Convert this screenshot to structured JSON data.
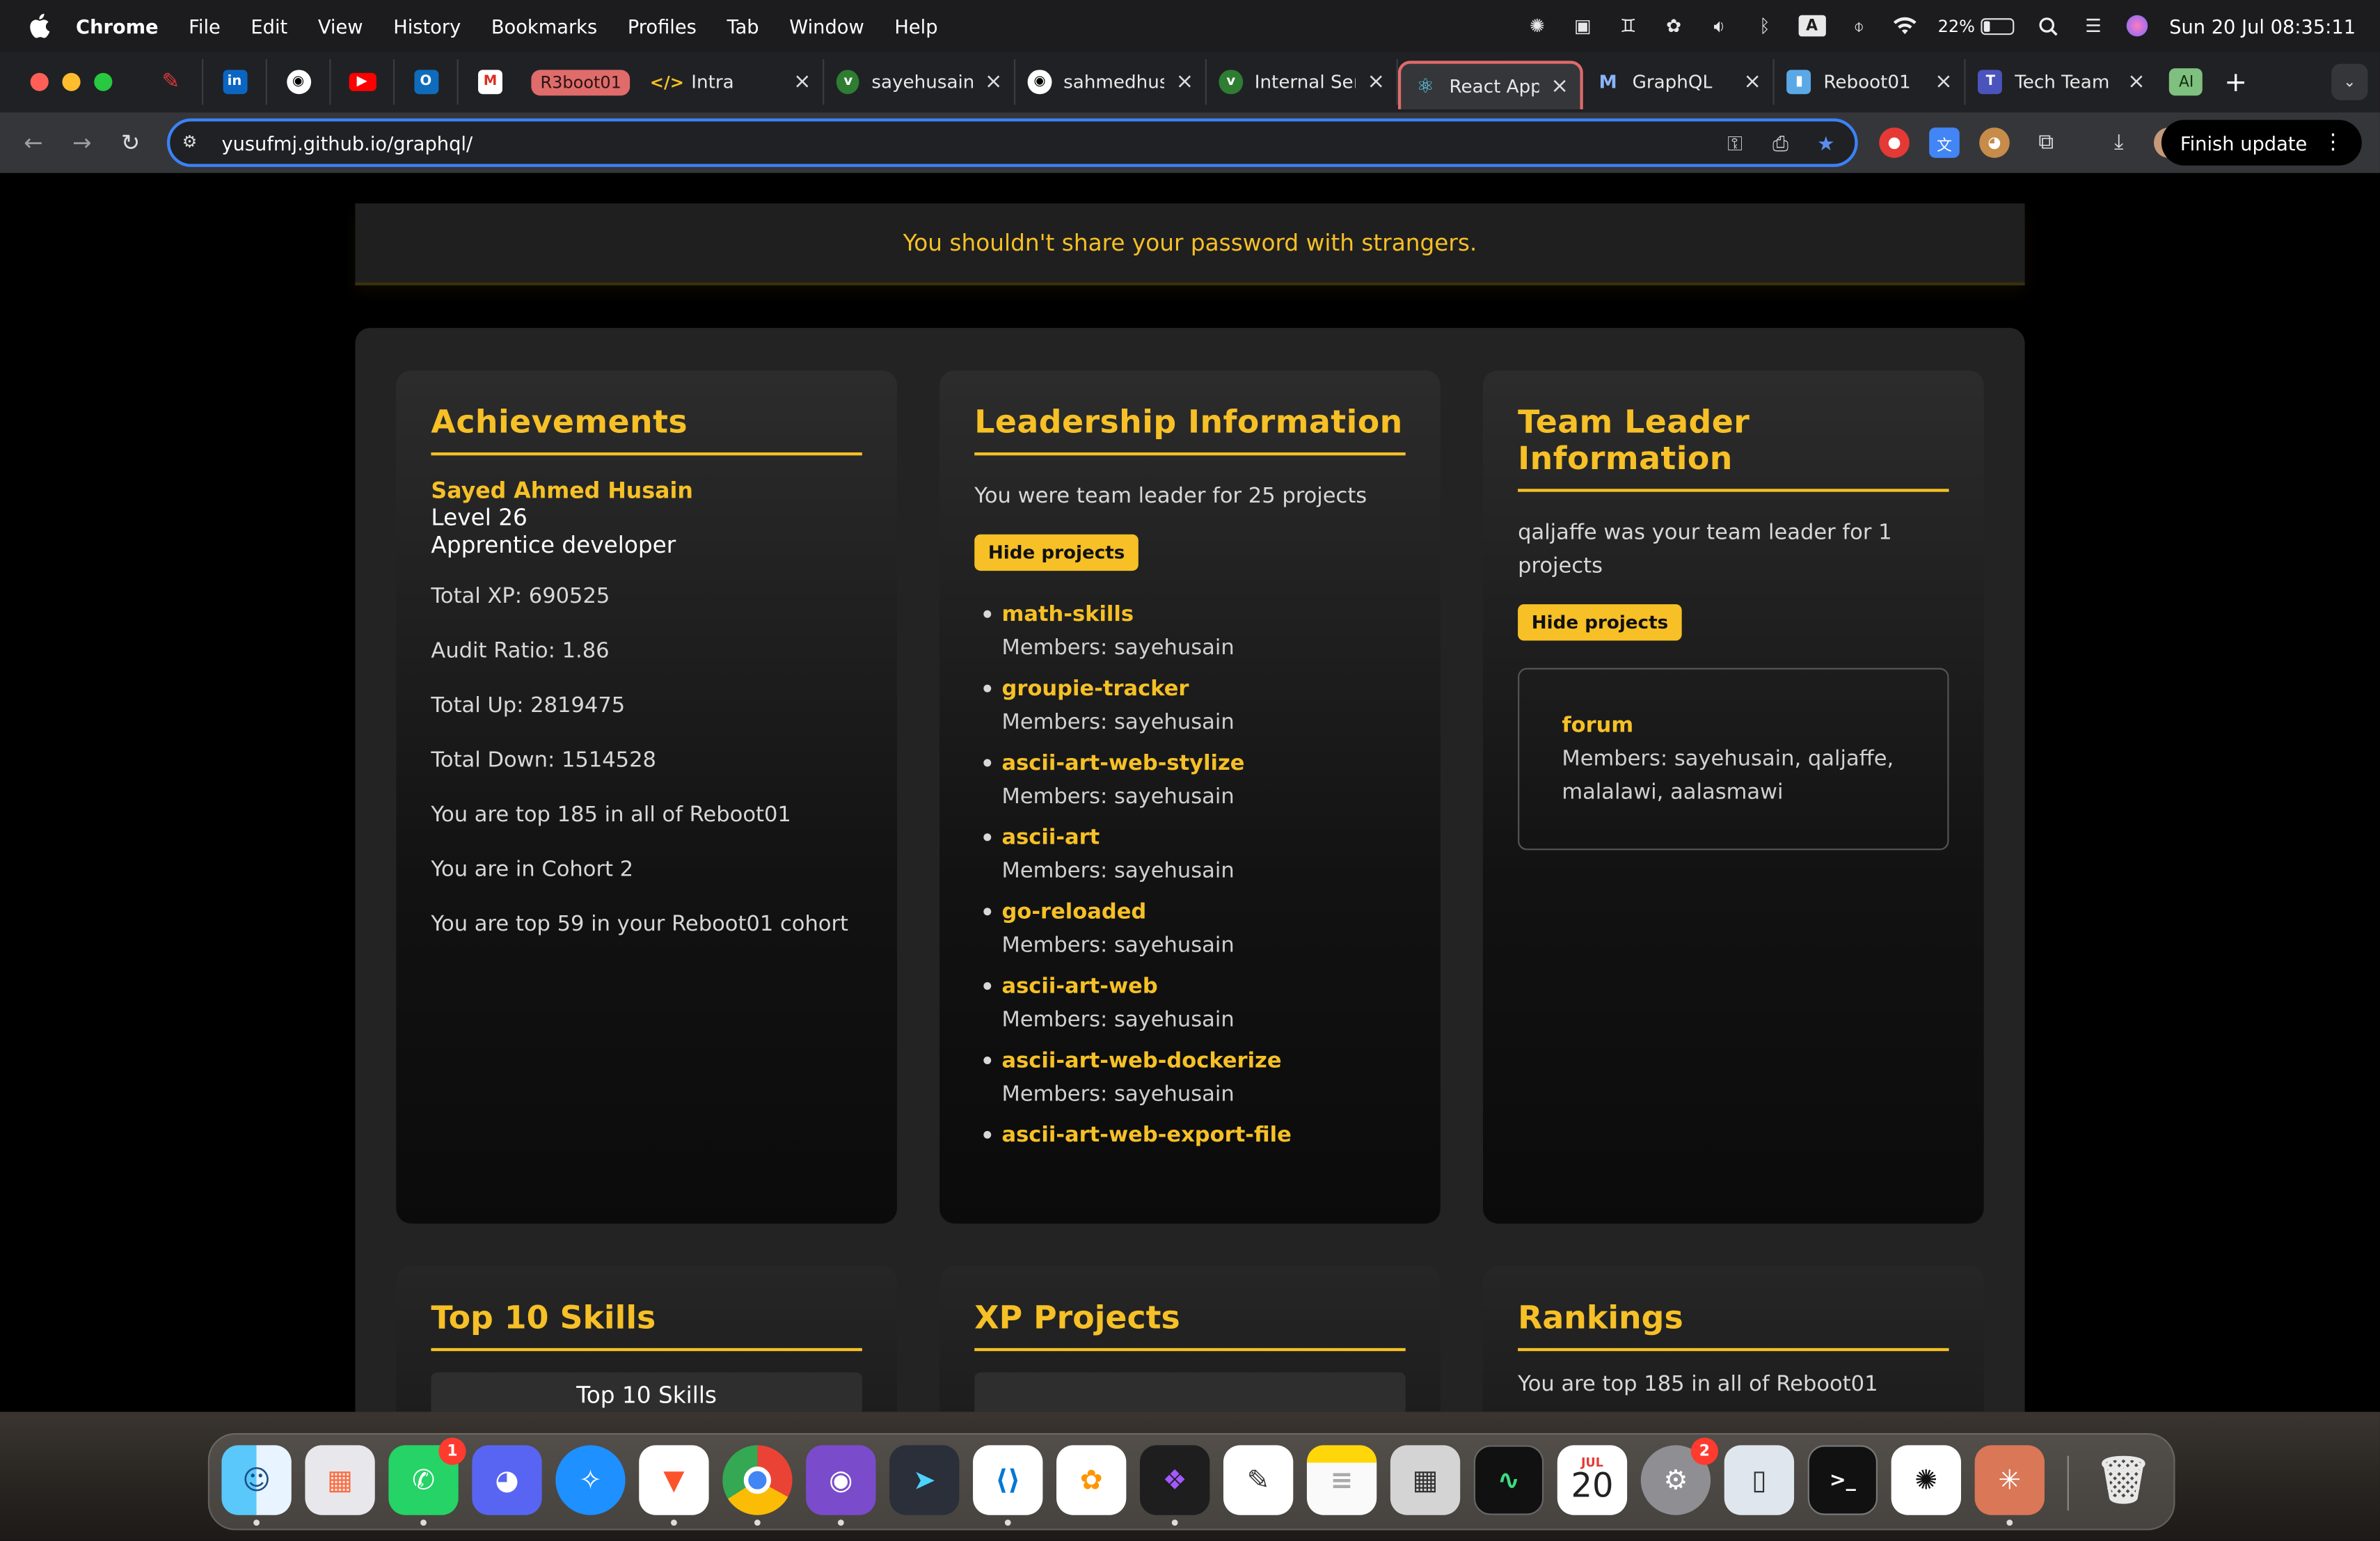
{
  "menubar": {
    "app_name": "Chrome",
    "items": [
      "File",
      "Edit",
      "View",
      "History",
      "Bookmarks",
      "Profiles",
      "Tab",
      "Window",
      "Help"
    ],
    "battery": "22%",
    "battery_level": 0.22,
    "input_source": "A",
    "datetime": "Sun 20 Jul  08:35:11"
  },
  "tabs": {
    "group_label": "R3boot01",
    "list": [
      {
        "title": "Intra",
        "favicon": "code-icon"
      },
      {
        "title": "sayehusain/",
        "favicon": "bird-icon"
      },
      {
        "title": "sahmedhus",
        "favicon": "github-icon"
      },
      {
        "title": "Internal Ser",
        "favicon": "bird-icon"
      },
      {
        "title": "React App",
        "favicon": "react-icon",
        "active": true
      },
      {
        "title": "GraphQL",
        "favicon": "m-icon"
      },
      {
        "title": "Reboot01",
        "favicon": "chart-icon"
      },
      {
        "title": "Tech Team",
        "favicon": "teams-icon"
      }
    ],
    "ai_label": "AI",
    "close_glyph": "×"
  },
  "toolbar": {
    "url": "yusufmj.github.io/graphql/",
    "finish_update": "Finish update"
  },
  "page": {
    "banner": "You shouldn't share your password with strangers.",
    "achievements": {
      "heading": "Achievements",
      "name": "Sayed Ahmed Husain",
      "level": "Level 26",
      "rank": "Apprentice developer",
      "stats": [
        "Total XP: 690525",
        "Audit Ratio: 1.86",
        "Total Up: 2819475",
        "Total Down: 1514528",
        "You are top 185 in all of Reboot01",
        "You are in Cohort 2",
        "You are top 59 in your Reboot01 cohort"
      ]
    },
    "leadership": {
      "heading": "Leadership Information",
      "summary": "You were team leader for 25 projects",
      "button": "Hide projects",
      "projects": [
        {
          "name": "math-skills",
          "members": "Members: sayehusain"
        },
        {
          "name": "groupie-tracker",
          "members": "Members: sayehusain"
        },
        {
          "name": "ascii-art-web-stylize",
          "members": "Members: sayehusain"
        },
        {
          "name": "ascii-art",
          "members": "Members: sayehusain"
        },
        {
          "name": "go-reloaded",
          "members": "Members: sayehusain"
        },
        {
          "name": "ascii-art-web",
          "members": "Members: sayehusain"
        },
        {
          "name": "ascii-art-web-dockerize",
          "members": "Members: sayehusain"
        },
        {
          "name": "ascii-art-web-export-file",
          "members": ""
        }
      ]
    },
    "team_leader": {
      "heading": "Team Leader Information",
      "summary": "qaljaffe was your team leader for 1 projects",
      "button": "Hide projects",
      "project_name": "forum",
      "project_members": "Members: sayehusain, qaljaffe, malalawi, aalasmawi"
    },
    "skills": {
      "heading": "Top 10 Skills",
      "box_title": "Top 10 Skills"
    },
    "xp_projects": {
      "heading": "XP Projects"
    },
    "rankings": {
      "heading": "Rankings",
      "text": "You are top 185 in all of Reboot01"
    }
  },
  "dock": {
    "calendar_month": "JUL",
    "calendar_day": "20",
    "whatsapp_badge": "1",
    "settings_badge": "2",
    "apps": [
      "finder",
      "launchpad",
      "whatsapp",
      "discord",
      "safari",
      "brave",
      "chrome",
      "github-desktop",
      "prompt",
      "vscode",
      "photos",
      "figma",
      "freeform",
      "notes",
      "calculator",
      "activity-monitor",
      "calendar",
      "system-settings",
      "simulator",
      "terminal",
      "chatgpt",
      "claude",
      "trash"
    ]
  },
  "colors": {
    "accent": "#f6c026",
    "tab_group": "#e06b6b",
    "focus": "#3b82f6"
  }
}
